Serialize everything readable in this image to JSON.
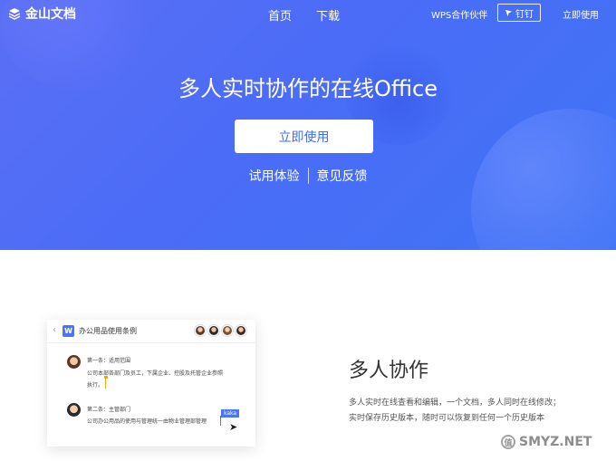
{
  "nav": {
    "logo_text": "金山文档",
    "home": "首页",
    "download": "下载",
    "partner": "WPS合作伙伴",
    "pin": "钉钉",
    "use_now": "立即使用"
  },
  "hero": {
    "title": "多人实时协作的在线Office",
    "cta": "立即使用",
    "trial": "试用体验",
    "feedback": "意见反馈"
  },
  "mockup": {
    "doc_icon": "W",
    "doc_title": "办公用品使用条例",
    "comment1_head": "第一条：适用范围",
    "comment1_line1": "公司本部各部门及员工，下属企业、控股及托管企业参照",
    "comment1_line2": "执行。",
    "comment2_head": "第二条：主管部门",
    "comment2_line1": "公司办公用品的使用与管理统一由物业管理部管理",
    "collaborator_tag": "kaka"
  },
  "feature": {
    "title": "多人协作",
    "desc_line1": "多人实时在线查看和编辑，一个文档，多人同时在线修改；",
    "desc_line2": "实时保存历史版本，随时可以恢复到任何一个历史版本"
  },
  "watermark": {
    "logo": "值",
    "text": "SMYZ.NET"
  },
  "colors": {
    "hero_gradient_start": "#5b6ff5",
    "hero_gradient_end": "#3f74f6",
    "accent": "#3e6ef2"
  }
}
